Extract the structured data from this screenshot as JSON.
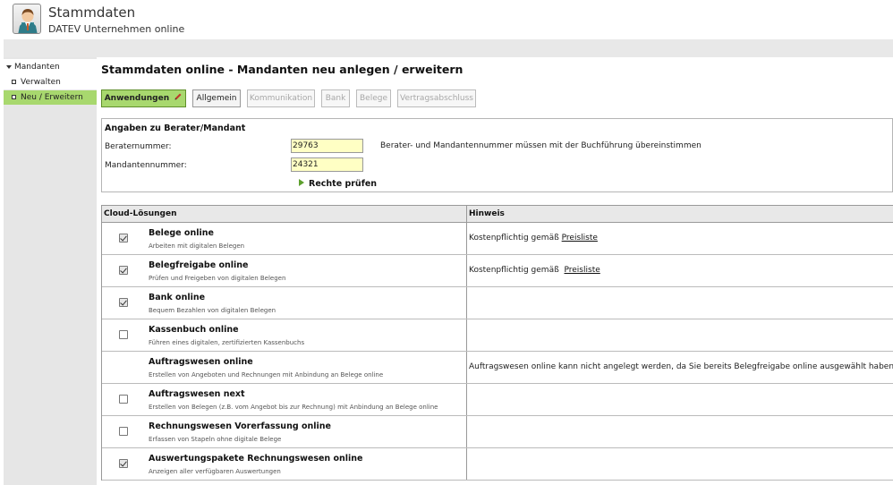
{
  "header": {
    "title": "Stammdaten",
    "subtitle": "DATEV Unternehmen online"
  },
  "sidebar": {
    "group": "Mandanten",
    "items": [
      {
        "label": "Verwalten",
        "active": false
      },
      {
        "label": "Neu / Erweitern",
        "active": true
      }
    ]
  },
  "main": {
    "title": "Stammdaten online - Mandanten neu anlegen / erweitern",
    "tabs": [
      {
        "label": "Anwendungen",
        "state": "active"
      },
      {
        "label": "Allgemein",
        "state": "enabled"
      },
      {
        "label": "Kommunikation",
        "state": "disabled"
      },
      {
        "label": "Bank",
        "state": "disabled"
      },
      {
        "label": "Belege",
        "state": "disabled"
      },
      {
        "label": "Vertragsabschluss",
        "state": "disabled"
      }
    ],
    "advisor_box": {
      "title": "Angaben zu Berater/Mandant",
      "advisor_label": "Beraternummer:",
      "advisor_value": "29763",
      "client_label": "Mandantennummer:",
      "client_value": "24321",
      "hint": "Berater- und Mandantennummer müssen mit der Buchführung übereinstimmen",
      "check_rights": "Rechte prüfen"
    },
    "table": {
      "col_solutions": "Cloud-Lösungen",
      "col_note": "Hinweis",
      "rows": [
        {
          "title": "Belege online",
          "desc": "Arbeiten mit digitalen Belegen",
          "checkbox": "checked",
          "note_prefix": "Kostenpflichtig gemäß",
          "note_link": "Preisliste",
          "note": ""
        },
        {
          "title": "Belegfreigabe online",
          "desc": "Prüfen und Freigeben von digitalen Belegen",
          "checkbox": "checked",
          "note_prefix": "Kostenpflichtig gemäß",
          "note_link": "Preisliste",
          "note": ""
        },
        {
          "title": "Bank online",
          "desc": "Bequem Bezahlen von digitalen Belegen",
          "checkbox": "checked",
          "note_prefix": "",
          "note_link": "",
          "note": ""
        },
        {
          "title": "Kassenbuch online",
          "desc": "Führen eines digitalen, zertifizierten Kassenbuchs",
          "checkbox": "unchecked",
          "note_prefix": "",
          "note_link": "",
          "note": ""
        },
        {
          "title": "Auftragswesen online",
          "desc": "Erstellen von Angeboten und Rechnungen mit Anbindung an Belege online",
          "checkbox": "none",
          "note_prefix": "",
          "note_link": "",
          "note": "Auftragswesen online kann nicht angelegt werden, da Sie bereits Belegfreigabe online ausgewählt haben."
        },
        {
          "title": "Auftragswesen next",
          "desc": "Erstellen von Belegen (z.B. vom Angebot bis zur Rechnung) mit Anbindung an Belege online",
          "checkbox": "unchecked",
          "note_prefix": "",
          "note_link": "",
          "note": ""
        },
        {
          "title": "Rechnungswesen Vorerfassung online",
          "desc": "Erfassen von Stapeln ohne digitale Belege",
          "checkbox": "unchecked",
          "note_prefix": "",
          "note_link": "",
          "note": ""
        },
        {
          "title": "Auswertungspakete Rechnungswesen online",
          "desc": "Anzeigen aller verfügbaren Auswertungen",
          "checkbox": "checked",
          "note_prefix": "",
          "note_link": "",
          "note": ""
        }
      ]
    }
  }
}
